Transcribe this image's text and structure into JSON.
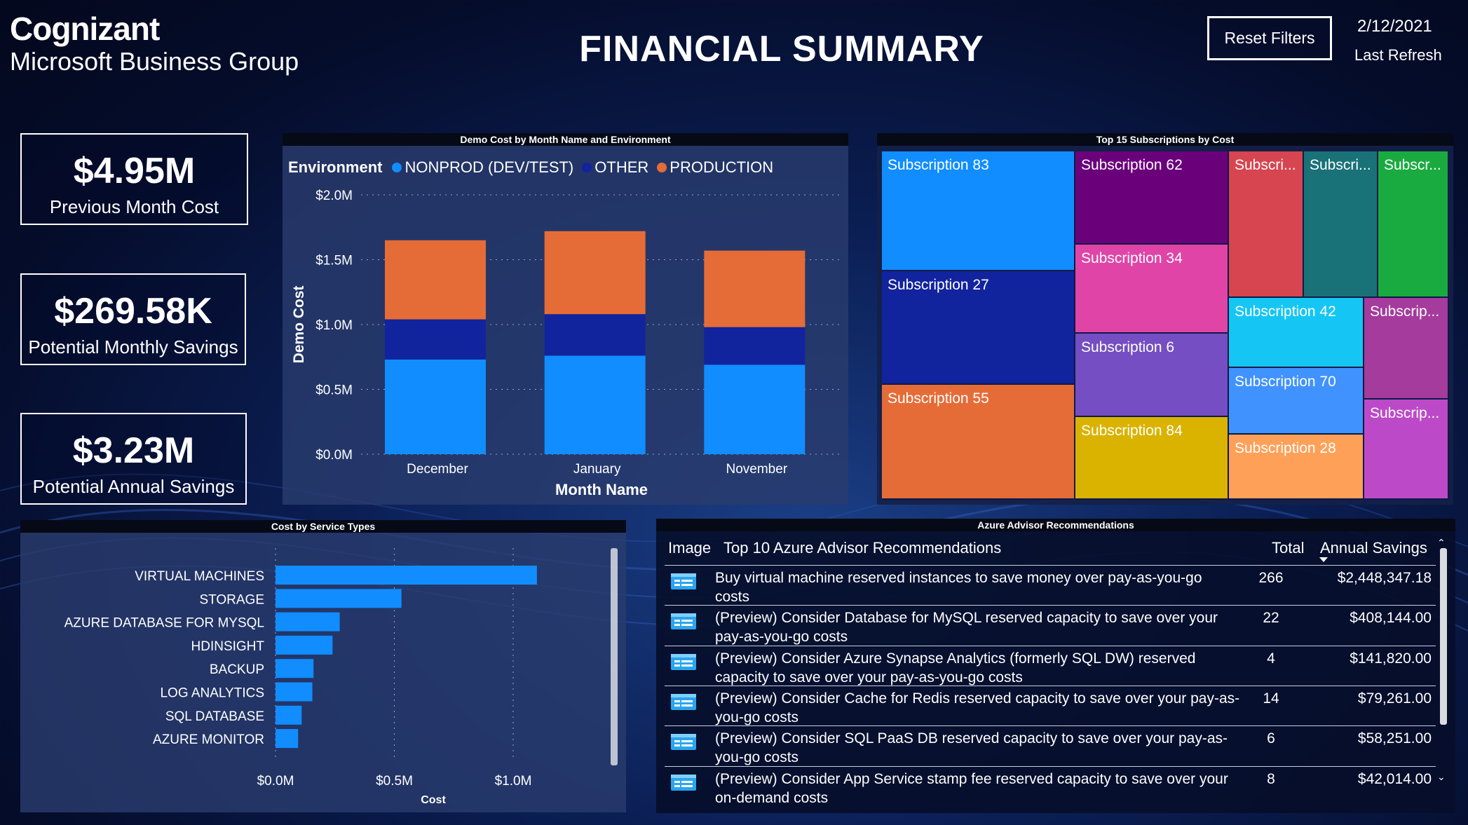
{
  "brand": {
    "name": "Cognizant",
    "subtitle": "Microsoft Business Group"
  },
  "header": {
    "title": "FINANCIAL SUMMARY",
    "reset_label": "Reset Filters",
    "refresh_date": "2/12/2021",
    "refresh_label": "Last Refresh"
  },
  "kpis": [
    {
      "value": "$4.95M",
      "label": "Previous Month Cost"
    },
    {
      "value": "$269.58K",
      "label": "Potential Monthly Savings"
    },
    {
      "value": "$3.23M",
      "label": "Potential Annual Savings"
    }
  ],
  "colors": {
    "nonprod": "#118dff",
    "other": "#12239e",
    "production": "#e66c37",
    "bar": "#118dff"
  },
  "chart_data": [
    {
      "type": "bar",
      "stacked": true,
      "title": "Demo Cost by Month Name and Environment",
      "legend_title": "Environment",
      "categories": [
        "December",
        "January",
        "November"
      ],
      "series": [
        {
          "name": "NONPROD (DEV/TEST)",
          "values": [
            0.73,
            0.76,
            0.69
          ]
        },
        {
          "name": "OTHER",
          "values": [
            0.31,
            0.32,
            0.29
          ]
        },
        {
          "name": "PRODUCTION",
          "values": [
            0.61,
            0.64,
            0.59
          ]
        }
      ],
      "xlabel": "Month Name",
      "ylabel": "Demo Cost",
      "ylim": [
        0,
        2.0
      ],
      "yticks": [
        "$0.0M",
        "$0.5M",
        "$1.0M",
        "$1.5M",
        "$2.0M"
      ],
      "grid": true,
      "legend_position": "top-left"
    },
    {
      "type": "bar",
      "orientation": "horizontal",
      "title": "Cost by Service Types",
      "categories": [
        "VIRTUAL MACHINES",
        "STORAGE",
        "AZURE DATABASE FOR MYSQL",
        "HDINSIGHT",
        "BACKUP",
        "LOG ANALYTICS",
        "SQL DATABASE",
        "AZURE MONITOR"
      ],
      "values": [
        1.1,
        0.53,
        0.27,
        0.24,
        0.16,
        0.155,
        0.11,
        0.095
      ],
      "xlabel": "Cost",
      "xticks": [
        "$0.0M",
        "$0.5M",
        "$1.0M"
      ],
      "xlim": [
        0,
        1.4
      ],
      "grid": true
    }
  ],
  "treemap": {
    "title": "Top 15 Subscriptions by Cost",
    "tiles": [
      {
        "label": "Subscription 83",
        "color": "#118dff"
      },
      {
        "label": "Subscription 27",
        "color": "#12239e"
      },
      {
        "label": "Subscription 55",
        "color": "#e66c37"
      },
      {
        "label": "Subscription 62",
        "color": "#6b007b"
      },
      {
        "label": "Subscription 34",
        "color": "#e044a7"
      },
      {
        "label": "Subscription 6",
        "color": "#744ec2"
      },
      {
        "label": "Subscription 84",
        "color": "#d9b300"
      },
      {
        "label": "Subscri...",
        "color": "#d64550"
      },
      {
        "label": "Subscri...",
        "color": "#197278"
      },
      {
        "label": "Subscr...",
        "color": "#1aab40"
      },
      {
        "label": "Subscription 42",
        "color": "#15c6f4"
      },
      {
        "label": "Subscrip...",
        "color": "#a43b9d"
      },
      {
        "label": "Subscription 70",
        "color": "#4092ff"
      },
      {
        "label": "Subscrip...",
        "color": "#bc4ac8"
      },
      {
        "label": "Subscription 28",
        "color": "#ffa058"
      }
    ]
  },
  "advisor": {
    "title": "Azure Advisor Recommendations",
    "columns": {
      "image": "Image",
      "rec": "Top 10 Azure Advisor Recommendations",
      "total": "Total",
      "savings": "Annual Savings"
    },
    "rows": [
      {
        "line1": "Buy virtual machine reserved instances to save money over pay-as-you-go",
        "line2": "costs",
        "total": "266",
        "savings": "$2,448,347.18"
      },
      {
        "line1": "(Preview) Consider Database for MySQL reserved capacity to save over your",
        "line2": "pay-as-you-go costs",
        "total": "22",
        "savings": "$408,144.00"
      },
      {
        "line1": "(Preview) Consider Azure Synapse Analytics (formerly SQL DW) reserved",
        "line2": "capacity to save over your pay-as-you-go costs",
        "total": "4",
        "savings": "$141,820.00"
      },
      {
        "line1": "(Preview) Consider Cache for Redis reserved capacity to save over your pay-as-",
        "line2": "you-go costs",
        "total": "14",
        "savings": "$79,261.00"
      },
      {
        "line1": "(Preview) Consider SQL PaaS DB reserved capacity to save over your pay-as-",
        "line2": "you-go costs",
        "total": "6",
        "savings": "$58,251.00"
      },
      {
        "line1": "(Preview) Consider App Service stamp fee reserved capacity to save over your",
        "line2": "on-demand costs",
        "total": "8",
        "savings": "$42,014.00"
      }
    ]
  }
}
